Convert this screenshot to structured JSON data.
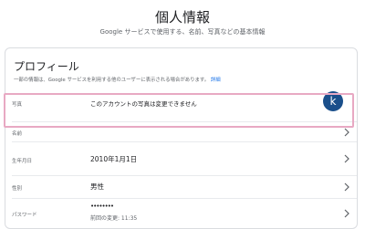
{
  "header": {
    "title": "個人情報",
    "subtitle": "Google サービスで使用する、名前、写真などの基本情報"
  },
  "profile": {
    "title": "プロフィール",
    "description": "一部の情報は、Google サービスを利用する他のユーザーに表示される場合があります。",
    "details_link": "詳細",
    "rows": {
      "photo": {
        "label": "写真",
        "value": "このアカウントの写真は変更できません",
        "avatar_letter": "k"
      },
      "name": {
        "label": "名前",
        "value": ""
      },
      "birthday": {
        "label": "生年月日",
        "value": "2010年1月1日"
      },
      "gender": {
        "label": "性別",
        "value": "男性"
      },
      "password": {
        "label": "パスワード",
        "value": "••••••••",
        "sub": "前回の変更: 11:35"
      }
    }
  },
  "colors": {
    "avatar": "#1a4f8b",
    "highlight": "#e8a9c3",
    "link": "#1a73e8"
  }
}
